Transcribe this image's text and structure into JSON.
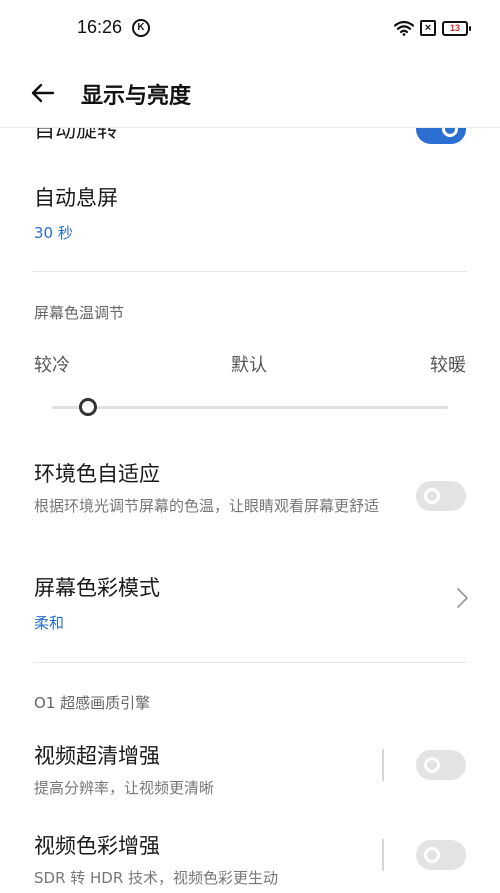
{
  "status_bar": {
    "time": "16:26",
    "k_badge": "K",
    "sim_icon": "×",
    "battery": "13"
  },
  "header": {
    "title": "显示与亮度"
  },
  "settings": {
    "auto_rotate": {
      "label": "自动旋转",
      "enabled": true
    },
    "auto_sleep": {
      "label": "自动息屏",
      "value": "30 秒"
    },
    "color_temp": {
      "section_label": "屏幕色温调节",
      "cool": "较冷",
      "default": "默认",
      "warm": "较暖",
      "slider_level": 0.09
    },
    "adaptive_color": {
      "label": "环境色自适应",
      "description": "根据环境光调节屏幕的色温，让眼睛观看屏幕更舒适",
      "enabled": false
    },
    "color_mode": {
      "label": "屏幕色彩模式",
      "value": "柔和"
    },
    "engine_section": {
      "label": "O1 超感画质引擎"
    },
    "video_hd": {
      "label": "视频超清增强",
      "description": "提高分辨率，让视频更清晰",
      "enabled": false
    },
    "video_color": {
      "label": "视频色彩增强",
      "description": "SDR 转 HDR 技术，视频色彩更生动",
      "enabled": false
    }
  },
  "colors": {
    "accent": "#2a6fd1",
    "toggle_off": "#e3e3e3"
  }
}
